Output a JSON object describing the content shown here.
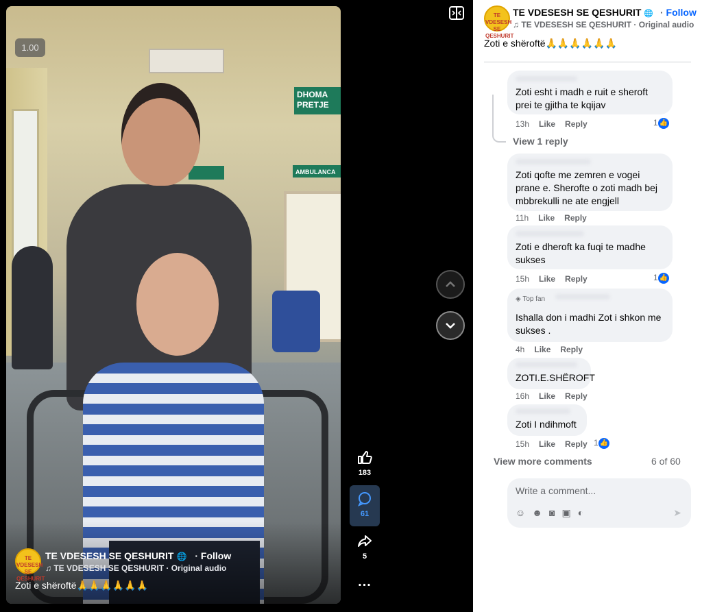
{
  "video": {
    "speed": "1.00",
    "signs": [
      "DHOMA",
      "PRETJE",
      "AMBULANCA"
    ]
  },
  "owner": {
    "page_name": "TE VDESESH SE QESHURIT",
    "follow": "Follow",
    "follow_sep": "·",
    "audio": "TE VDESESH SE QESHURIT · Original audio",
    "avatar_text": "TE VDESESH SE QESHURIT",
    "caption": "Zoti e shëroftë🙏🙏🙏🙏🙏🙏"
  },
  "actions": {
    "likes": "183",
    "comments": "61",
    "shares": "5",
    "more": "..."
  },
  "comments": [
    {
      "text": "Zoti esht i madh e ruit e sheroft prei te gjitha te kqijav",
      "time": "13h",
      "like": "Like",
      "reply": "Reply",
      "reactions": "1"
    },
    {
      "text": "Zoti qofte me zemren e vogei prane e. Sherofte o zoti madh bej mbbrekulli ne ate engjell",
      "time": "11h",
      "like": "Like",
      "reply": "Reply"
    },
    {
      "text": "Zoti e dheroft ka fuqi te madhe sukses",
      "time": "15h",
      "like": "Like",
      "reply": "Reply",
      "reactions": "1"
    },
    {
      "badge": "Top fan",
      "text": "Ishalla don i madhi Zot i shkon me sukses .",
      "time": "4h",
      "like": "Like",
      "reply": "Reply"
    },
    {
      "text": "ZOTI.E.SHËROFT",
      "time": "16h",
      "like": "Like",
      "reply": "Reply"
    },
    {
      "text": "Zoti I ndihmoft",
      "time": "15h",
      "like": "Like",
      "reply": "Reply",
      "reactions": "1"
    }
  ],
  "view_replies": "View 1 reply",
  "view_more": "View more comments",
  "count": "6 of 60",
  "composer": {
    "placeholder": "Write a comment...",
    "icons": [
      "avatar-sticker-icon",
      "emoji-icon",
      "camera-icon",
      "gif-icon",
      "sticker-icon",
      "send-icon"
    ]
  },
  "colors": {
    "accent": "#0866ff",
    "bubble": "#f0f2f5",
    "comment_active": "#263951"
  }
}
